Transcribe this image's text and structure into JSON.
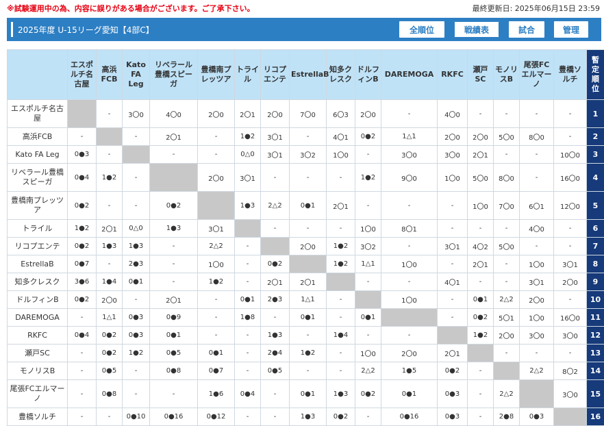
{
  "notice": "※試験運用中の為、内容に誤りがある場合がございます。ご了承下さい。",
  "last_updated": "最終更新日: 2025年06月15日 23:59",
  "header": {
    "title": "2025年度 U-15リーグ愛知【4部C】",
    "nav": [
      "全順位",
      "戦績表",
      "試合",
      "管理"
    ],
    "active_nav": "戦績表"
  },
  "colors": {
    "header_bg": "#2d7fc4",
    "column_header_bg": "#bfe2f7",
    "rank_bg": "#163a7a",
    "self_cell": "#c8c8c8",
    "notice": "#e60012"
  },
  "table": {
    "rank_header": "暫定順位",
    "columns": [
      "エスポルチ名古屋",
      "高浜FCB",
      "Kato FA Leg",
      "リベラール豊橋スピーガ",
      "豊橋南プレッツア",
      "トライル",
      "リコプエンテ",
      "EstrellaB",
      "知多クレスク",
      "ドルフィンB",
      "DAREMOGA",
      "RKFC",
      "瀬戸SC",
      "モノリスB",
      "尾張FCエルマーノ",
      "豊橋ソルチ"
    ],
    "rows": [
      {
        "team": "エスポルチ名古屋",
        "rank": "1",
        "cells": [
          "",
          "-",
          "3〇0",
          "4〇0",
          "2〇0",
          "2〇1",
          "2〇0",
          "7〇0",
          "6〇3",
          "2〇0",
          "-",
          "4〇0",
          "-",
          "-",
          "-",
          "-"
        ]
      },
      {
        "team": "高浜FCB",
        "rank": "2",
        "cells": [
          "-",
          "",
          "-",
          "2〇1",
          "-",
          "1●2",
          "3〇1",
          "-",
          "4〇1",
          "0●2",
          "1△1",
          "2〇0",
          "2〇0",
          "5〇0",
          "8〇0",
          "-"
        ]
      },
      {
        "team": "Kato FA Leg",
        "rank": "3",
        "cells": [
          "0●3",
          "-",
          "",
          "-",
          "-",
          "0△0",
          "3〇1",
          "3〇2",
          "1〇0",
          "-",
          "3〇0",
          "3〇0",
          "2〇1",
          "-",
          "-",
          "10〇0"
        ]
      },
      {
        "team": "リベラール豊橋スピーガ",
        "rank": "4",
        "cells": [
          "0●4",
          "1●2",
          "-",
          "",
          "2〇0",
          "3〇1",
          "-",
          "-",
          "-",
          "1●2",
          "9〇0",
          "1〇0",
          "5〇0",
          "8〇0",
          "-",
          "16〇0"
        ]
      },
      {
        "team": "豊橋南プレッツア",
        "rank": "5",
        "cells": [
          "0●2",
          "-",
          "-",
          "0●2",
          "",
          "1●3",
          "2△2",
          "0●1",
          "2〇1",
          "-",
          "-",
          "-",
          "1〇0",
          "7〇0",
          "6〇1",
          "12〇0"
        ]
      },
      {
        "team": "トライル",
        "rank": "6",
        "cells": [
          "1●2",
          "2〇1",
          "0△0",
          "1●3",
          "3〇1",
          "",
          "-",
          "-",
          "-",
          "1〇0",
          "8〇1",
          "-",
          "-",
          "-",
          "4〇0",
          "-"
        ]
      },
      {
        "team": "リコプエンテ",
        "rank": "7",
        "cells": [
          "0●2",
          "1●3",
          "1●3",
          "-",
          "2△2",
          "-",
          "",
          "2〇0",
          "1●2",
          "3〇2",
          "-",
          "3〇1",
          "4〇2",
          "5〇0",
          "-",
          "-"
        ]
      },
      {
        "team": "EstrellaB",
        "rank": "8",
        "cells": [
          "0●7",
          "-",
          "2●3",
          "-",
          "1〇0",
          "-",
          "0●2",
          "",
          "1●2",
          "1△1",
          "1〇0",
          "-",
          "2〇1",
          "-",
          "1〇0",
          "3〇1"
        ]
      },
      {
        "team": "知多クレスク",
        "rank": "9",
        "cells": [
          "3●6",
          "1●4",
          "0●1",
          "-",
          "1●2",
          "-",
          "2〇1",
          "2〇1",
          "",
          "-",
          "-",
          "4〇1",
          "-",
          "-",
          "3〇1",
          "2〇0"
        ]
      },
      {
        "team": "ドルフィンB",
        "rank": "10",
        "cells": [
          "0●2",
          "2〇0",
          "-",
          "2〇1",
          "-",
          "0●1",
          "2●3",
          "1△1",
          "-",
          "",
          "1〇0",
          "-",
          "0●1",
          "2△2",
          "2〇0",
          "-"
        ]
      },
      {
        "team": "DAREMOGA",
        "rank": "11",
        "cells": [
          "-",
          "1△1",
          "0●3",
          "0●9",
          "-",
          "1●8",
          "-",
          "0●1",
          "-",
          "0●1",
          "",
          "-",
          "0●2",
          "5〇1",
          "1〇0",
          "16〇0"
        ]
      },
      {
        "team": "RKFC",
        "rank": "12",
        "cells": [
          "0●4",
          "0●2",
          "0●3",
          "0●1",
          "-",
          "-",
          "1●3",
          "-",
          "1●4",
          "-",
          "-",
          "",
          "1●2",
          "2〇0",
          "3〇0",
          "3〇0"
        ]
      },
      {
        "team": "瀬戸SC",
        "rank": "13",
        "cells": [
          "-",
          "0●2",
          "1●2",
          "0●5",
          "0●1",
          "-",
          "2●4",
          "1●2",
          "-",
          "1〇0",
          "2〇0",
          "2〇1",
          "",
          "-",
          "-",
          "-"
        ]
      },
      {
        "team": "モノリスB",
        "rank": "14",
        "cells": [
          "-",
          "0●5",
          "-",
          "0●8",
          "0●7",
          "-",
          "0●5",
          "-",
          "-",
          "2△2",
          "1●5",
          "0●2",
          "-",
          "",
          "2△2",
          "8〇2"
        ]
      },
      {
        "team": "尾張FCエルマーノ",
        "rank": "15",
        "cells": [
          "-",
          "0●8",
          "-",
          "-",
          "1●6",
          "0●4",
          "-",
          "0●1",
          "1●3",
          "0●2",
          "0●1",
          "0●3",
          "-",
          "2△2",
          "",
          "3〇0"
        ]
      },
      {
        "team": "豊橋ソルチ",
        "rank": "16",
        "cells": [
          "-",
          "-",
          "0●10",
          "0●16",
          "0●12",
          "-",
          "-",
          "1●3",
          "0●2",
          "-",
          "0●16",
          "0●3",
          "-",
          "2●8",
          "0●3",
          ""
        ]
      }
    ]
  }
}
